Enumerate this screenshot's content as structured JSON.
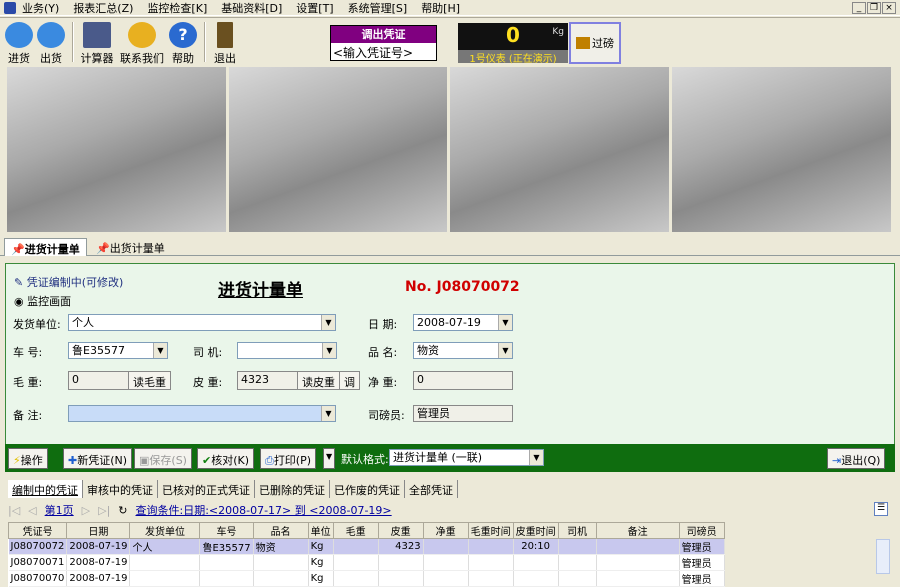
{
  "menu": [
    "业务(Y)",
    "报表汇总(Z)",
    "监控检查[K]",
    "基础资料[D]",
    "设置[T]",
    "系统管理[S]",
    "帮助[H]"
  ],
  "window_buttons": [
    "_",
    "❐",
    "×"
  ],
  "toolbar": [
    {
      "label": "进货",
      "color": "#3a8ae0"
    },
    {
      "label": "出货",
      "color": "#3a8ae0"
    },
    {
      "label": "计算器",
      "color": "#4a5a8a"
    },
    {
      "label": "联系我们",
      "color": "#e8b020"
    },
    {
      "label": "帮助",
      "color": "#2a6ad0"
    },
    {
      "label": "退出",
      "color": "#6a5020"
    }
  ],
  "voucher_lookup": {
    "title": "调出凭证",
    "placeholder": "<输入凭证号>"
  },
  "scale": {
    "value": "0",
    "unit": "Kg",
    "status": "1号仪表 (正在演示)",
    "weigh_button": "过磅"
  },
  "tabs": [
    "进货计量单",
    "出货计量单"
  ],
  "form": {
    "status": "凭证编制中(可修改)",
    "monitor": "监控画面",
    "title": "进货计量单",
    "number": "No. J08070072",
    "supplier_label": "发货单位:",
    "supplier": "个人",
    "date_label": "日    期:",
    "date": "2008-07-19",
    "plate_label": "车    号:",
    "plate": "鲁E35577",
    "driver_label": "司    机:",
    "driver": "",
    "product_label": "品    名:",
    "product": "物资",
    "gross_label": "毛    重:",
    "gross": "0",
    "read_gross": "读毛重",
    "tare_label": "皮    重:",
    "tare": "4323",
    "read_tare": "读皮重",
    "adjust": "调",
    "net_label": "净    重:",
    "net": "0",
    "note_label": "备    注:",
    "note": "",
    "weigher_label": "司磅员:",
    "weigher": "管理员"
  },
  "actions": {
    "operate": "操作",
    "new": "新凭证(N)",
    "save": "保存(S)",
    "verify": "核对(K)",
    "print": "打印(P)",
    "format_label": "默认格式:",
    "format": "进货计量单 (一联)",
    "exit": "退出(Q)"
  },
  "list_tabs": [
    "编制中的凭证",
    "审核中的凭证",
    "已核对的正式凭证",
    "已删除的凭证",
    "已作废的凭证",
    "全部凭证"
  ],
  "pager": {
    "page": "第1页",
    "query": "查询条件:日期:<2008-07-17> 到 <2008-07-19>"
  },
  "table": {
    "headers": [
      "凭证号",
      "日期",
      "发货单位",
      "车号",
      "品名",
      "单位",
      "毛重",
      "皮重",
      "净重",
      "毛重时间",
      "皮重时间",
      "司机",
      "备注",
      "司磅员"
    ],
    "rows": [
      [
        "J08070072",
        "2008-07-19",
        "个人",
        "鲁E35577",
        "物资",
        "Kg",
        "",
        "4323",
        "",
        "",
        "20:10",
        "",
        "",
        "管理员"
      ],
      [
        "J08070071",
        "2008-07-19",
        "",
        "",
        "",
        "Kg",
        "",
        "",
        "",
        "",
        "",
        "",
        "",
        "管理员"
      ],
      [
        "J08070070",
        "2008-07-19",
        "",
        "",
        "",
        "Kg",
        "",
        "",
        "",
        "",
        "",
        "",
        "",
        "管理员"
      ]
    ]
  }
}
